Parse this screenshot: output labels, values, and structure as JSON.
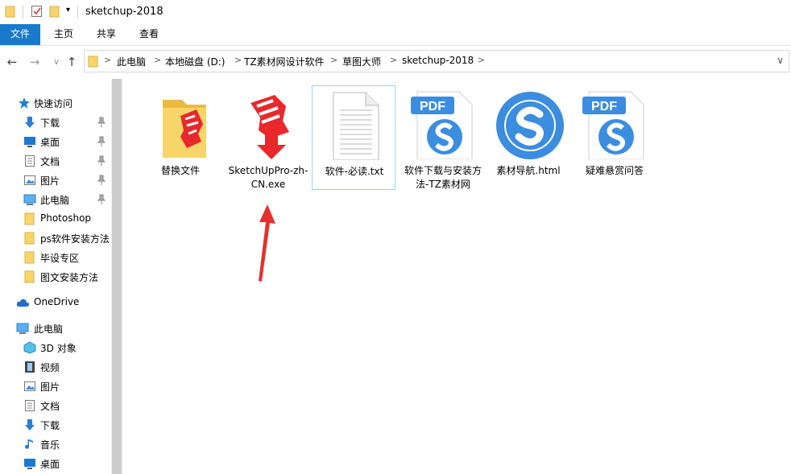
{
  "window": {
    "title": "sketchup-2018"
  },
  "ribbon": {
    "tabs": [
      {
        "label": "文件",
        "active": true
      },
      {
        "label": "主页"
      },
      {
        "label": "共享"
      },
      {
        "label": "查看"
      }
    ]
  },
  "address": {
    "crumbs": [
      "此电脑",
      "本地磁盘 (D:)",
      "TZ素材网设计软件",
      "草图大师",
      "sketchup-2018"
    ],
    "separator": ">",
    "dropdown_glyph": "∨"
  },
  "nav": {
    "back_glyph": "←",
    "forward_glyph": "→",
    "recent_glyph": "∨",
    "up_glyph": "↑"
  },
  "sidebar": {
    "quick_access": {
      "label": "快速访问"
    },
    "pinned": [
      {
        "label": "下载",
        "icon": "download-icon"
      },
      {
        "label": "桌面",
        "icon": "desktop-icon"
      },
      {
        "label": "文档",
        "icon": "documents-icon"
      },
      {
        "label": "图片",
        "icon": "pictures-icon"
      },
      {
        "label": "此电脑",
        "icon": "computer-icon"
      }
    ],
    "folders": [
      {
        "label": "Photoshop"
      },
      {
        "label": "ps软件安装方法"
      },
      {
        "label": "毕设专区"
      },
      {
        "label": "图文安装方法"
      }
    ],
    "onedrive": {
      "label": "OneDrive"
    },
    "this_pc": {
      "label": "此电脑"
    },
    "this_pc_items": [
      {
        "label": "3D 对象",
        "icon": "3d-objects-icon"
      },
      {
        "label": "视频",
        "icon": "videos-icon"
      },
      {
        "label": "图片",
        "icon": "pictures-icon"
      },
      {
        "label": "文档",
        "icon": "documents-icon"
      },
      {
        "label": "下载",
        "icon": "download-icon"
      },
      {
        "label": "音乐",
        "icon": "music-icon"
      },
      {
        "label": "桌面",
        "icon": "desktop-icon"
      }
    ]
  },
  "files": [
    {
      "name": "替换文件",
      "icon": "sketchup-folder-icon"
    },
    {
      "name": "SketchUpPro-zh-CN.exe",
      "icon": "sketchup-installer-icon"
    },
    {
      "name": "软件-必读.txt",
      "icon": "text-file-icon",
      "selected": true
    },
    {
      "name": "软件下载与安装方法-TZ素材网",
      "icon": "pdf-icon"
    },
    {
      "name": "素材导航.html",
      "icon": "sogou-browser-icon"
    },
    {
      "name": "疑难悬赏问答",
      "icon": "pdf-icon"
    }
  ],
  "annotation": {
    "icon": "red-arrow-icon",
    "color": "#e53030"
  },
  "colors": {
    "accent": "#1979ca",
    "folder": "#f7d569",
    "sketchup_red": "#e8282b",
    "pdf_blue": "#3b8de0"
  }
}
